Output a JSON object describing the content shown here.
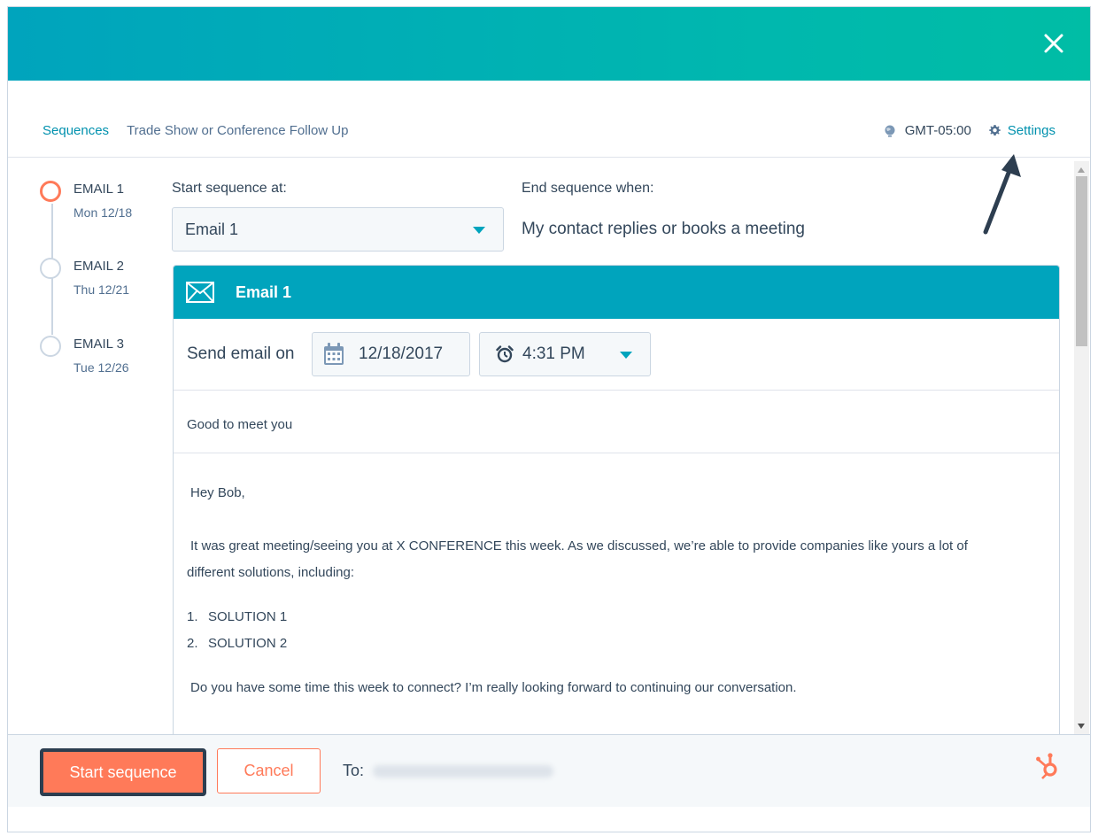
{
  "header": {
    "close_icon": "close-icon",
    "gradient": [
      "#00a4bd",
      "#00bda5"
    ]
  },
  "breadcrumb": {
    "link": "Sequences",
    "current": "Trade Show or Conference Follow Up"
  },
  "top_right": {
    "timezone": "GMT-05:00",
    "settings_label": "Settings"
  },
  "timeline": [
    {
      "title": "EMAIL 1",
      "date": "Mon 12/18"
    },
    {
      "title": "EMAIL 2",
      "date": "Thu 12/21"
    },
    {
      "title": "EMAIL 3",
      "date": "Tue 12/26"
    }
  ],
  "start": {
    "label": "Start sequence at:",
    "value": "Email 1"
  },
  "end": {
    "label": "End sequence when:",
    "value": "My contact replies or books a meeting"
  },
  "email": {
    "title": "Email 1",
    "send_label": "Send email on",
    "date": "12/18/2017",
    "time": "4:31 PM",
    "subject": "Good to meet you",
    "greeting": "Hey Bob,",
    "paragraph1": "It was great meeting/seeing you at X CONFERENCE this week. As we discussed, we’re able to provide companies like yours a lot of",
    "paragraph1_cont": "different solutions, including:",
    "list": [
      {
        "num": "1.",
        "text": "SOLUTION 1"
      },
      {
        "num": "2.",
        "text": "SOLUTION 2"
      }
    ],
    "paragraph2": "Do you have some time this week to connect? I’m really looking forward to continuing our conversation."
  },
  "footer": {
    "start_button": "Start sequence",
    "cancel_button": "Cancel",
    "to_label": "To:"
  },
  "colors": {
    "accent": "#00a4bd",
    "primary_button": "#ff7a59",
    "link": "#0091ae",
    "text": "#33475b"
  }
}
